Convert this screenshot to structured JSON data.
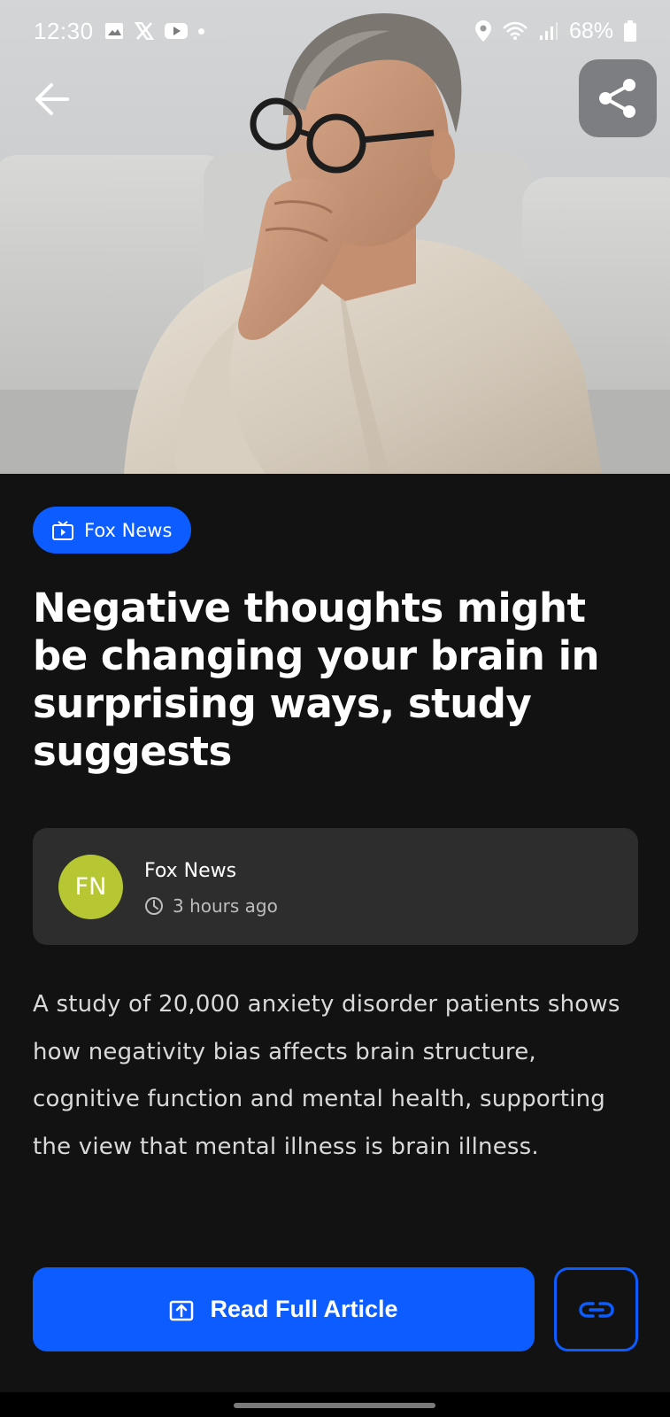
{
  "status_bar": {
    "time": "12:30",
    "battery": "68%",
    "left_icons": [
      "gallery-icon",
      "x-logo-icon",
      "youtube-icon",
      "notification-dot"
    ],
    "right_icons": [
      "location-icon",
      "wifi-icon",
      "signal-icon",
      "battery-icon"
    ]
  },
  "hero": {
    "image_alt": "Man with glasses thinking, hand on chin",
    "back_icon": "arrow-left-icon",
    "share_icon": "share-icon"
  },
  "source": {
    "label": "Fox News",
    "icon": "tv-icon"
  },
  "article": {
    "title": "Negative thoughts might be changing your brain in surprising ways, study suggests",
    "summary": "A study of 20,000 anxiety disorder patients shows how negativity bias affects brain structure, cognitive function and mental health, supporting the view that mental illness is brain illness."
  },
  "author": {
    "initials": "FN",
    "name": "Fox News",
    "time_ago": "3 hours ago",
    "avatar_color": "#b6c733"
  },
  "actions": {
    "read_label": "Read Full Article",
    "read_icon": "open-external-icon",
    "link_icon": "link-icon"
  },
  "colors": {
    "accent": "#0d5cff",
    "background": "#121212",
    "card": "#2d2d2d"
  }
}
